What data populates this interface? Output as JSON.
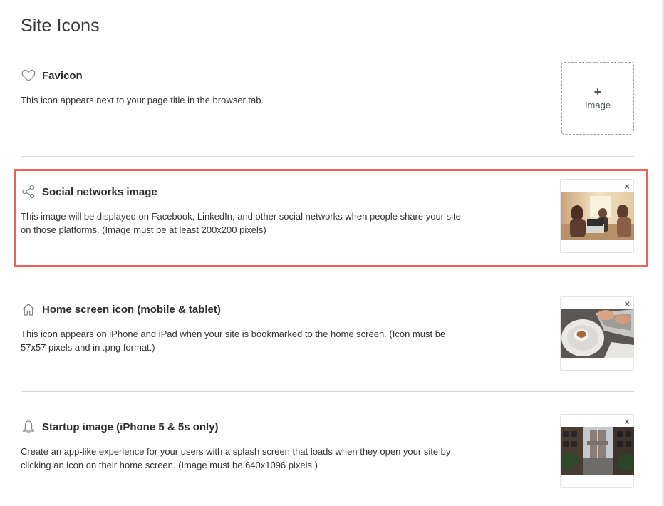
{
  "page": {
    "title": "Site Icons"
  },
  "sections": [
    {
      "title": "Favicon",
      "icon": "heart-icon",
      "description": "This icon appears next to your page title in the browser tab.",
      "upload": {
        "plus": "+",
        "label": "Image"
      }
    },
    {
      "title": "Social networks image",
      "icon": "share-icon",
      "description": "This image will be displayed on Facebook, LinkedIn, and other social networks when people share your site on those platforms. (Image must be at least 200x200 pixels)",
      "close": "×",
      "thumbnail": "photo-people-at-laptops"
    },
    {
      "title": "Home screen icon (mobile & tablet)",
      "icon": "home-icon",
      "description": "This icon appears on iPhone and iPad when your site is bookmarked to the home screen. (Icon must be 57x57 pixels and in .png format.)",
      "close": "×",
      "thumbnail": "photo-coffee-and-laptop"
    },
    {
      "title": "Startup image (iPhone 5 & 5s only)",
      "icon": "bell-icon",
      "description": "Create an app-like experience for your users with a splash screen that loads when they open your site by clicking an icon on their home screen. (Image must be 640x1096 pixels.)",
      "close": "×",
      "thumbnail": "photo-city-bridge-street"
    }
  ],
  "colors": {
    "highlight": "#e8645a",
    "divider": "#d8d8d8",
    "text": "#2d2d2d"
  }
}
